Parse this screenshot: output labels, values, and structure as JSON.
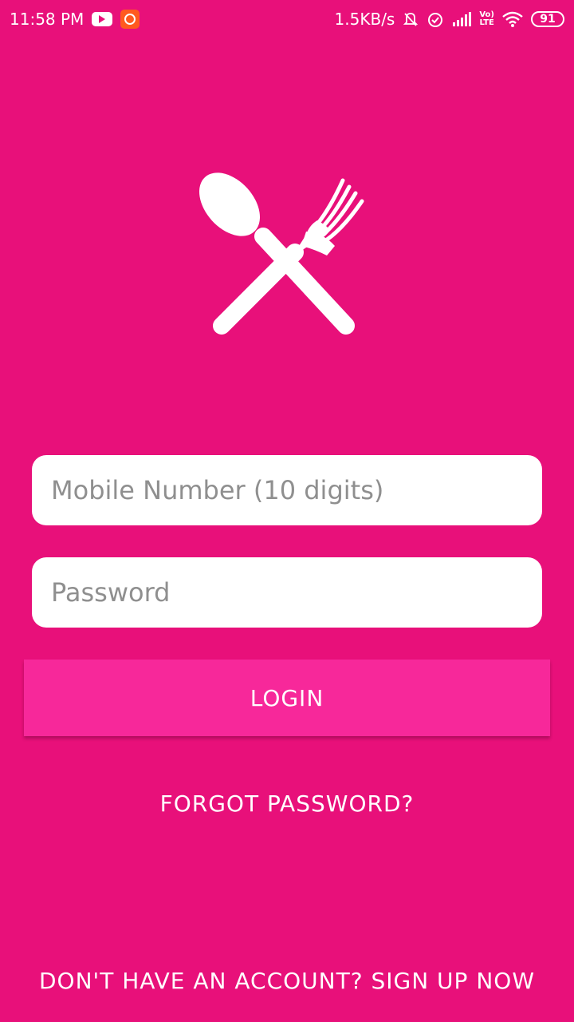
{
  "status_bar": {
    "time": "11:58 PM",
    "network_speed": "1.5KB/s",
    "network_type_top": "Vo)",
    "network_type_bottom": "LTE",
    "battery": "91",
    "icons": [
      "youtube-icon",
      "app-notification-icon",
      "mute-bell-icon",
      "alarm-icon",
      "signal-icon",
      "volte-icon",
      "wifi-icon",
      "battery-icon"
    ]
  },
  "logo": {
    "icon": "spoon-fork-icon"
  },
  "login_form": {
    "mobile_placeholder": "Mobile Number (10 digits)",
    "mobile_value": "",
    "password_placeholder": "Password",
    "password_value": "",
    "login_label": "LOGIN",
    "forgot_label": "FORGOT PASSWORD?",
    "signup_label": "DON'T HAVE AN ACCOUNT? SIGN UP NOW"
  },
  "colors": {
    "background": "#E8107A",
    "button": "#F7289A",
    "field": "#FFFFFF"
  }
}
